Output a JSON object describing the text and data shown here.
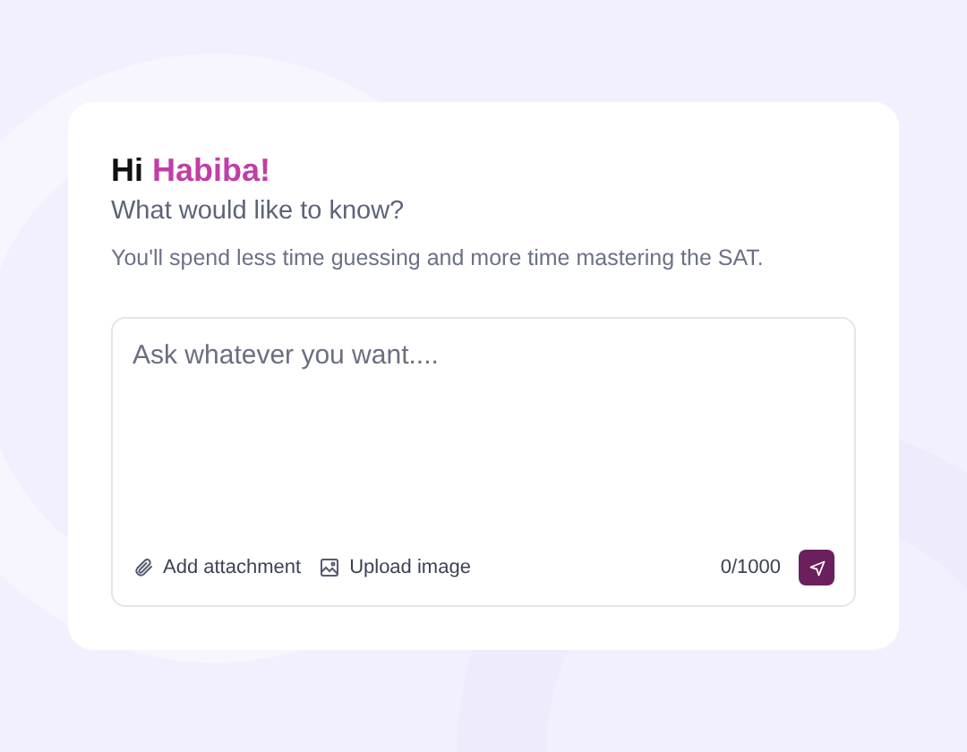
{
  "greeting": {
    "prefix": "Hi",
    "name": "Habiba!"
  },
  "subtitle": "What would like to know?",
  "description": "You'll spend less time guessing and more time mastering the SAT.",
  "prompt": {
    "placeholder": "Ask whatever you want....",
    "counter": "0/1000"
  },
  "actions": [
    {
      "kind": "attachment",
      "label": "Add attachment"
    },
    {
      "kind": "image",
      "label": "Upload image"
    }
  ]
}
